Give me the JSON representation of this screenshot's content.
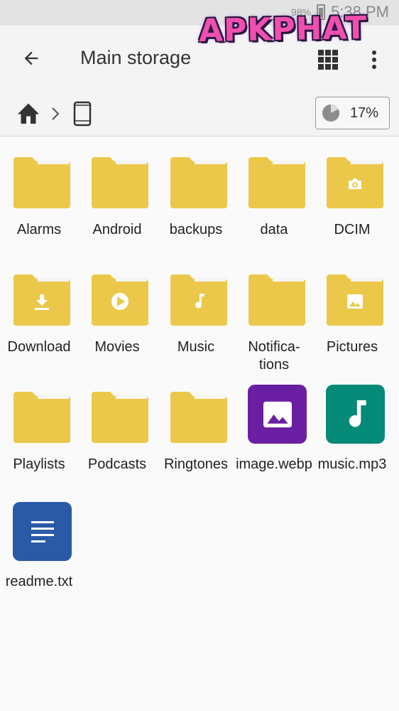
{
  "status_bar": {
    "battery": "98%",
    "time": "5:38 PM"
  },
  "app_bar": {
    "title": "Main storage",
    "back_icon": "arrow-back-icon",
    "view_icon": "grid-view-icon",
    "more_icon": "more-vert-icon"
  },
  "watermark": {
    "text": "APKPHAT"
  },
  "path_bar": {
    "home_icon": "home-icon",
    "device_icon": "phone-device-icon",
    "usage_percent": "17%",
    "usage_fraction": 0.17
  },
  "colors": {
    "folder": "#ebc84a",
    "folder_tab": "#f5f5f5",
    "image_file": "#6a1fa3",
    "music_file": "#068a78",
    "text_file": "#2a5aa6"
  },
  "items": [
    {
      "label": "Alarms",
      "type": "folder",
      "badge": ""
    },
    {
      "label": "Android",
      "type": "folder",
      "badge": ""
    },
    {
      "label": "backups",
      "type": "folder",
      "badge": ""
    },
    {
      "label": "data",
      "type": "folder",
      "badge": ""
    },
    {
      "label": "DCIM",
      "type": "folder",
      "badge": "camera-icon"
    },
    {
      "label": "Download",
      "type": "folder",
      "badge": "download-icon"
    },
    {
      "label": "Movies",
      "type": "folder",
      "badge": "play-icon"
    },
    {
      "label": "Music",
      "type": "folder",
      "badge": "music-note-icon"
    },
    {
      "label": "Notifica-\ntions",
      "type": "folder",
      "badge": ""
    },
    {
      "label": "Pictures",
      "type": "folder",
      "badge": "image-icon"
    },
    {
      "label": "Playlists",
      "type": "folder",
      "badge": ""
    },
    {
      "label": "Podcasts",
      "type": "folder",
      "badge": ""
    },
    {
      "label": "Ringtones",
      "type": "folder",
      "badge": ""
    },
    {
      "label": "image.webp",
      "type": "image",
      "badge": "image-icon"
    },
    {
      "label": "music.mp3",
      "type": "music",
      "badge": "music-note-icon"
    },
    {
      "label": "readme.txt",
      "type": "text",
      "badge": "document-lines-icon"
    }
  ]
}
